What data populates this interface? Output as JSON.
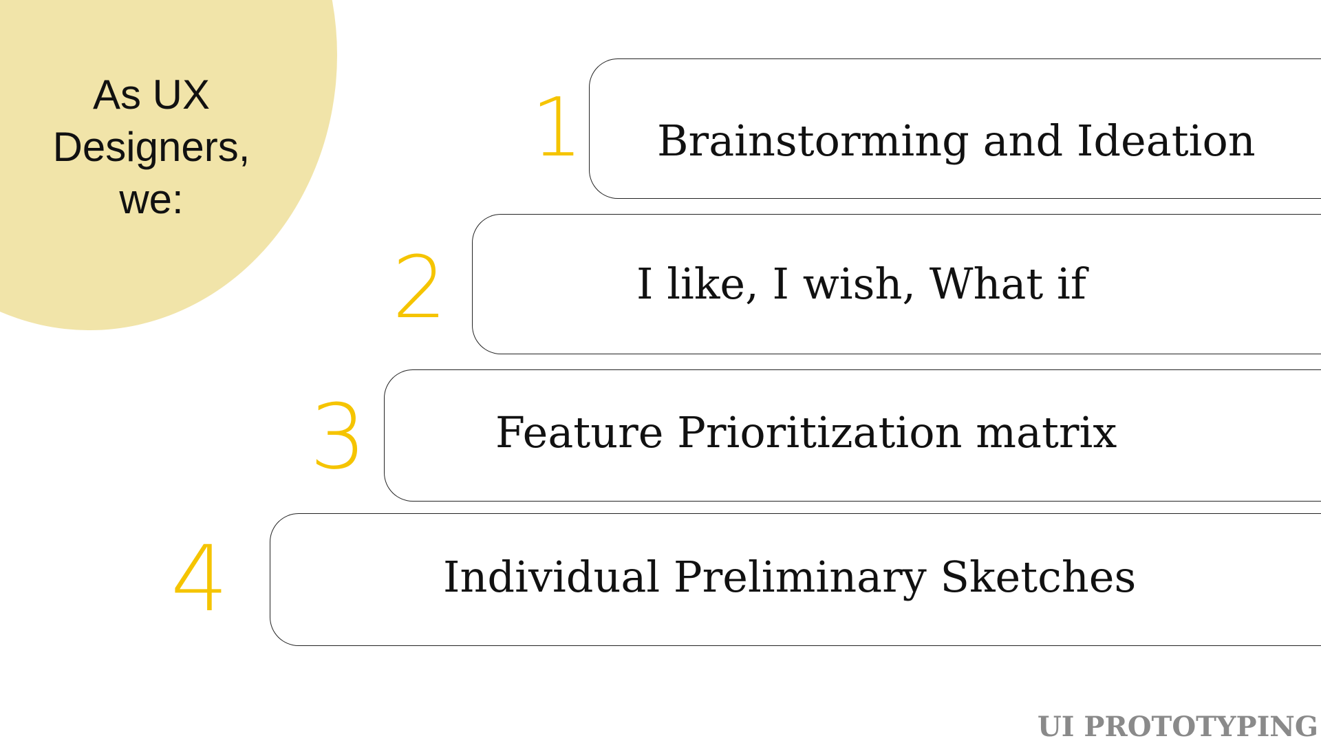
{
  "intro": {
    "lines": [
      "As UX",
      "Designers,",
      "we:"
    ]
  },
  "steps": [
    {
      "number": "1",
      "label": "Brainstorming and Ideation"
    },
    {
      "number": "2",
      "label": "I like, I wish, What if"
    },
    {
      "number": "3",
      "label": "Feature Prioritization matrix"
    },
    {
      "number": "4",
      "label": "Individual Preliminary Sketches"
    }
  ],
  "footer": {
    "label": "UI PROTOTYPING"
  },
  "colors": {
    "accent": "#f5c400",
    "circle": "#f1e4a9",
    "footer": "#8a8a8a"
  }
}
